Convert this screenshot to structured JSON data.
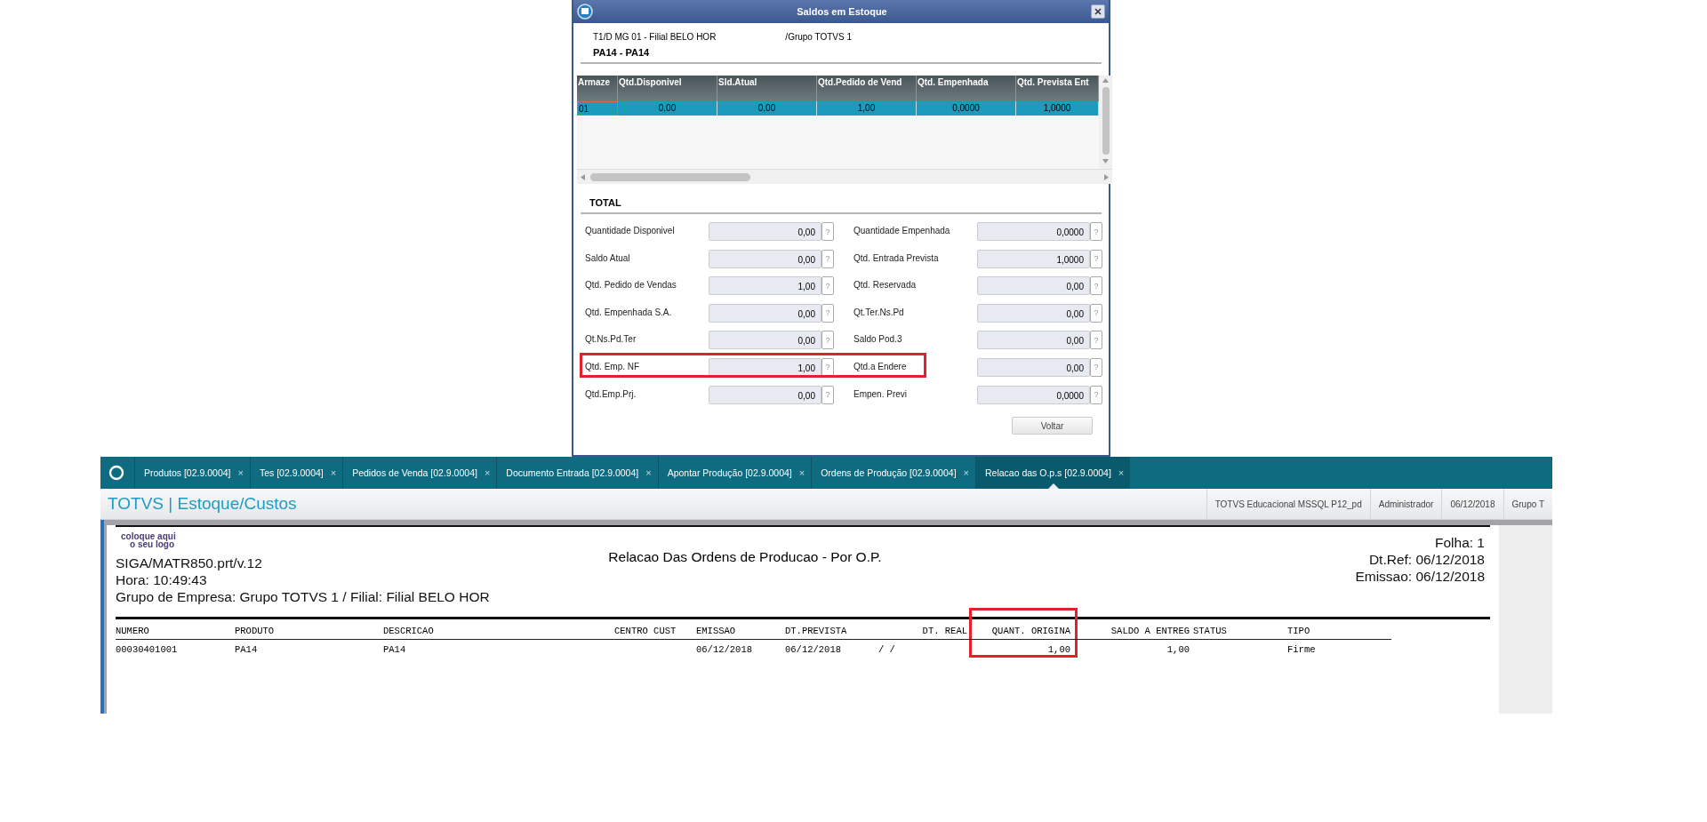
{
  "dialog": {
    "title": "Saldos em Estoque",
    "branch": "T1/D MG 01  - Filial BELO HOR",
    "group": "/Grupo TOTVS 1",
    "product": "PA14 - PA14",
    "grid": {
      "columns": [
        "Armaze",
        "Qtd.Disponivel",
        "Sld.Atual",
        "Qtd.Pedido de Vend",
        "Qtd. Empenhada",
        "Qtd. Prevista Ent"
      ],
      "rows": [
        {
          "selected": true,
          "cells": [
            "01",
            "0,00",
            "0,00",
            "1,00",
            "0,0000",
            "1,0000"
          ]
        }
      ]
    },
    "totals": {
      "title": "TOTAL",
      "help": "?",
      "rows": [
        {
          "highlighted": false,
          "left": {
            "label": "Quantidade Disponivel",
            "value": "0,00"
          },
          "right": {
            "label": "Quantidade Empenhada",
            "value": "0,0000"
          }
        },
        {
          "highlighted": false,
          "left": {
            "label": "Saldo Atual",
            "value": "0,00"
          },
          "right": {
            "label": "Qtd. Entrada Prevista",
            "value": "1,0000"
          }
        },
        {
          "highlighted": false,
          "left": {
            "label": "Qtd. Pedido de Vendas",
            "value": "1,00"
          },
          "right": {
            "label": "Qtd. Reservada",
            "value": "0,00"
          }
        },
        {
          "highlighted": false,
          "left": {
            "label": "Qtd. Empenhada S.A.",
            "value": "0,00"
          },
          "right": {
            "label": "Qt.Ter.Ns.Pd",
            "value": "0,00"
          }
        },
        {
          "highlighted": false,
          "left": {
            "label": "Qt.Ns.Pd.Ter",
            "value": "0,00"
          },
          "right": {
            "label": "Saldo Pod.3",
            "value": "0,00"
          }
        },
        {
          "highlighted": true,
          "left": {
            "label": "Qtd. Emp. NF",
            "value": "1,00"
          },
          "right": {
            "label": "Qtd.a Endere",
            "value": "0,00"
          }
        },
        {
          "highlighted": false,
          "left": {
            "label": "Qtd.Emp.Prj.",
            "value": "0,00"
          },
          "right": {
            "label": "Empen. Previ",
            "value": "0,0000"
          }
        }
      ]
    },
    "buttons": [
      "Voltar"
    ]
  },
  "app": {
    "tabs": [
      {
        "label": "Produtos [02.9.0004]",
        "close": "×",
        "selected": false
      },
      {
        "label": "Tes [02.9.0004]",
        "close": "×",
        "selected": false
      },
      {
        "label": "Pedidos de Venda [02.9.0004]",
        "close": "×",
        "selected": false
      },
      {
        "label": "Documento Entrada [02.9.0004]",
        "close": "×",
        "selected": false
      },
      {
        "label": "Apontar Produção [02.9.0004]",
        "close": "×",
        "selected": false
      },
      {
        "label": "Ordens de Produção [02.9.0004]",
        "close": "×",
        "selected": false
      },
      {
        "label": "Relacao das O.p.s [02.9.0004]",
        "close": "×",
        "selected": true
      }
    ],
    "title": "TOTVS | Estoque/Custos",
    "info": [
      "TOTVS Educacional MSSQL P12_pd",
      "Administrador",
      "06/12/2018",
      "Grupo T"
    ],
    "report": {
      "logo": [
        "coloque aqui",
        "o seu logo"
      ],
      "program": "SIGA/MATR850.prt/v.12",
      "heading": "Relacao Das Ordens de Producao - Por O.P.",
      "time": "Hora: 10:49:43",
      "company": "Grupo de Empresa: Grupo TOTVS 1 / Filial: Filial BELO HOR",
      "meta": [
        "Folha:    1",
        "Dt.Ref: 06/12/2018",
        "Emissao: 06/12/2018"
      ],
      "columns": [
        {
          "label": "NUMERO",
          "numeric": false,
          "highlighted": false
        },
        {
          "label": "PRODUTO",
          "numeric": false,
          "highlighted": false
        },
        {
          "label": "DESCRICAO",
          "numeric": false,
          "highlighted": false
        },
        {
          "label": "CENTRO CUST",
          "numeric": false,
          "highlighted": false
        },
        {
          "label": "EMISSAO",
          "numeric": false,
          "highlighted": false
        },
        {
          "label": "DT.PREVISTA",
          "numeric": false,
          "highlighted": false
        },
        {
          "label": "DT. REAL",
          "numeric": false,
          "highlighted": false
        },
        {
          "label": "QUANT. ORIGINA",
          "numeric": true,
          "highlighted": true
        },
        {
          "label": "SALDO A ENTREG",
          "numeric": true,
          "highlighted": false
        },
        {
          "label": "STATUS",
          "numeric": false,
          "highlighted": false
        },
        {
          "label": "TIPO",
          "numeric": false,
          "highlighted": false
        }
      ],
      "rows": [
        [
          "00030401001",
          "PA14",
          "PA14",
          "",
          "06/12/2018",
          "06/12/2018",
          "/  /",
          "1,00",
          "1,00",
          "",
          "Firme"
        ]
      ]
    }
  }
}
